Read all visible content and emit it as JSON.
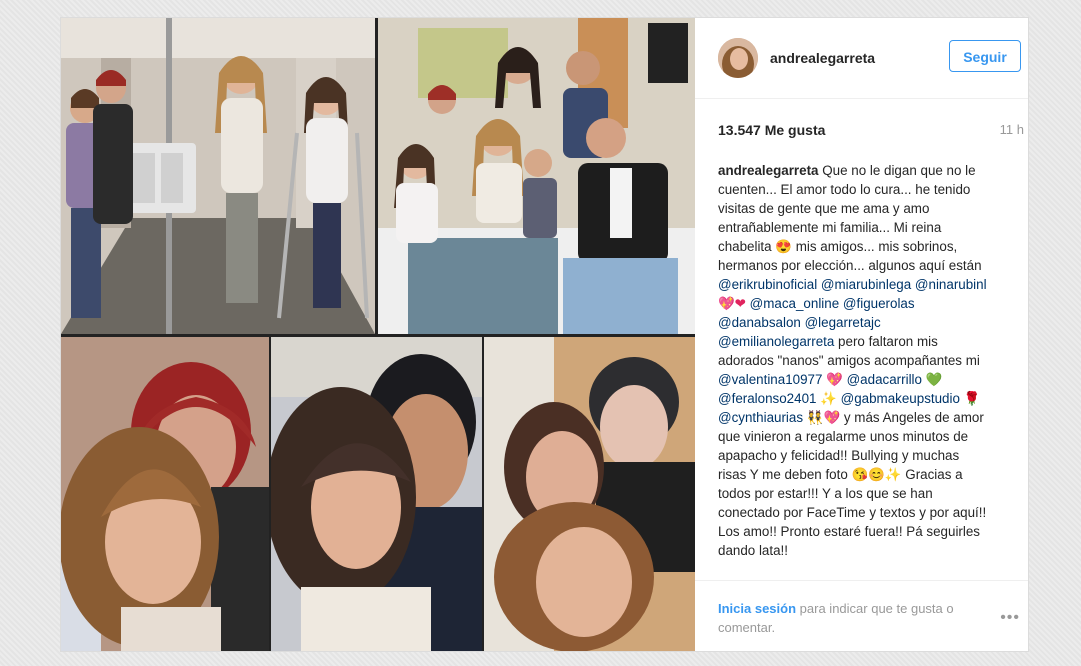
{
  "post": {
    "username": "andrealegarreta",
    "follow_label": "Seguir",
    "likes": "13.547 Me gusta",
    "time": "11 h",
    "caption": {
      "author": "andrealegarreta",
      "text_1": "Que no le digan que no le cuenten... El amor todo lo cura... he tenido visitas de gente que me ama y amo entrañablemente mi familia... Mi reina chabelita",
      "emoji_1": "😍",
      "text_2": "mis amigos... mis sobrinos, hermanos por elección... algunos aquí están",
      "mention_1": "@erikrubinoficial",
      "mention_2": "@miarubinlega",
      "mention_3": "@ninarubinl",
      "emoji_2": "💖❤",
      "mention_4": "@maca_online",
      "mention_5": "@figuerolas",
      "mention_6": "@danabsalon",
      "mention_7": "@legarretajc",
      "mention_8": "@emilianolegarreta",
      "text_3": "pero faltaron mis adorados \"nanos\" amigos acompañantes mi",
      "mention_9": "@valentina10977",
      "emoji_3": "💖",
      "mention_10": "@adacarrillo",
      "emoji_4": "💚",
      "mention_11": "@feralonso2401",
      "emoji_5": "✨",
      "mention_12": "@gabmakeupstudio",
      "emoji_6": "🌹",
      "mention_13": "@cynthiaurias",
      "emoji_7": "👯💖",
      "text_4": "y más Angeles de amor que vinieron a regalarme unos minutos de apapacho y felicidad!! Bullying y muchas risas Y me deben foto",
      "emoji_8": "😘😊✨",
      "text_5": "Gracias a todos por estar!!! Y a los que se han conectado por FaceTime y textos y por aquí!! Los amo!! Pronto estaré fuera!! Pá seguirles dando lata!!"
    },
    "footer": {
      "login_link": "Inicia sesión",
      "login_text": "para indicar que te gusta o comentar.",
      "more_label": "•••"
    }
  }
}
